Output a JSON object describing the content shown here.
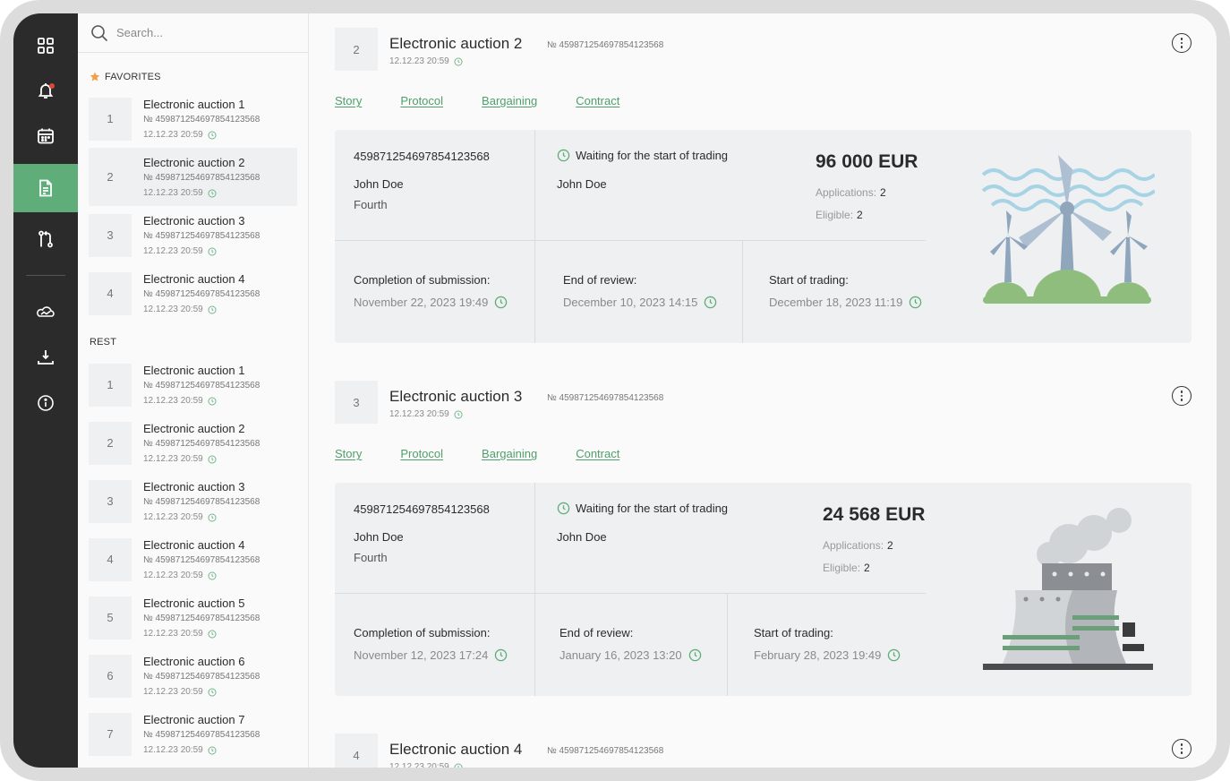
{
  "colors": {
    "accent": "#5fae7a",
    "link": "#4f9f6a",
    "rail": "#2b2b2b",
    "panel": "#eef0f2"
  },
  "rail": {
    "items": [
      {
        "icon": "grid-icon"
      },
      {
        "icon": "bell-icon"
      },
      {
        "icon": "calendar-icon"
      },
      {
        "icon": "document-icon",
        "active": true
      },
      {
        "icon": "git-compare-icon"
      },
      {
        "icon": "cloud-icon"
      },
      {
        "icon": "download-icon"
      },
      {
        "icon": "info-icon"
      }
    ]
  },
  "search": {
    "placeholder": "Search..."
  },
  "favorites": {
    "label": "FAVORITES",
    "items": [
      {
        "num": "1",
        "title": "Electronic auction 1",
        "no": "№ 4598712546978541235​68",
        "date": "12.12.23  20:59"
      },
      {
        "num": "2",
        "title": "Electronic auction 2",
        "no": "№ 459871254697854123568",
        "date": "12.12.23  20:59",
        "selected": true
      },
      {
        "num": "3",
        "title": "Electronic auction 3",
        "no": "№ 459871254697854123568",
        "date": "12.12.23  20:59"
      },
      {
        "num": "4",
        "title": "Electronic auction 4",
        "no": "№ 459871254697854123568",
        "date": "12.12.23  20:59"
      }
    ]
  },
  "rest": {
    "label": "REST",
    "items": [
      {
        "num": "1",
        "title": "Electronic auction 1",
        "no": "№ 459871254697854123568",
        "date": "12.12.23  20:59"
      },
      {
        "num": "2",
        "title": "Electronic auction 2",
        "no": "№ 459871254697854123568",
        "date": "12.12.23  20:59"
      },
      {
        "num": "3",
        "title": "Electronic auction 3",
        "no": "№ 459871254697854123568",
        "date": "12.12.23  20:59"
      },
      {
        "num": "4",
        "title": "Electronic auction 4",
        "no": "№ 459871254697854123568",
        "date": "12.12.23  20:59"
      },
      {
        "num": "5",
        "title": "Electronic auction 5",
        "no": "№ 459871254697854123568",
        "date": "12.12.23  20:59"
      },
      {
        "num": "6",
        "title": "Electronic auction 6",
        "no": "№ 459871254697854123568",
        "date": "12.12.23  20:59"
      },
      {
        "num": "7",
        "title": "Electronic auction 7",
        "no": "№ 459871254697854123568",
        "date": "12.12.23  20:59"
      }
    ]
  },
  "tabs": [
    "Story",
    "Protocol",
    "Bargaining",
    "Contract"
  ],
  "labels": {
    "completion": "Completion of submission:",
    "review": "End of review:",
    "trading": "Start of trading:",
    "applications": "Applications:",
    "eligible": "Eligible:"
  },
  "cards": [
    {
      "num": "2",
      "title": "Electronic auction 2",
      "no": "№ 459871254697854123568",
      "date": "12.12.23  20:59",
      "code": "459871254697854123568",
      "person": "John Doe",
      "round": "Fourth",
      "status": "Waiting for the start of trading",
      "status_person": "John Doe",
      "price": "96 000 EUR",
      "applications": "2",
      "eligible": "2",
      "completion_date": "November 22, 2023 19:49",
      "review_date": "December 10, 2023 14:15",
      "trading_date": "December 18, 2023 11:19",
      "illustration": "wind-turbines"
    },
    {
      "num": "3",
      "title": "Electronic auction 3",
      "no": "№ 459871254697854123568",
      "date": "12.12.23  20:59",
      "code": "459871254697854123568",
      "person": "John Doe",
      "round": "Fourth",
      "status": "Waiting for the start of trading",
      "status_person": "John Doe",
      "price": "24 568 EUR",
      "applications": "2",
      "eligible": "2",
      "completion_date": "November 12, 2023 17:24",
      "review_date": "January 16, 2023 13:20",
      "trading_date": "February 28, 2023 19:49",
      "illustration": "power-plant"
    },
    {
      "num": "4",
      "title": "Electronic auction 4",
      "no": "№ 459871254697854123568",
      "date": "12.12.23  20:59"
    }
  ]
}
